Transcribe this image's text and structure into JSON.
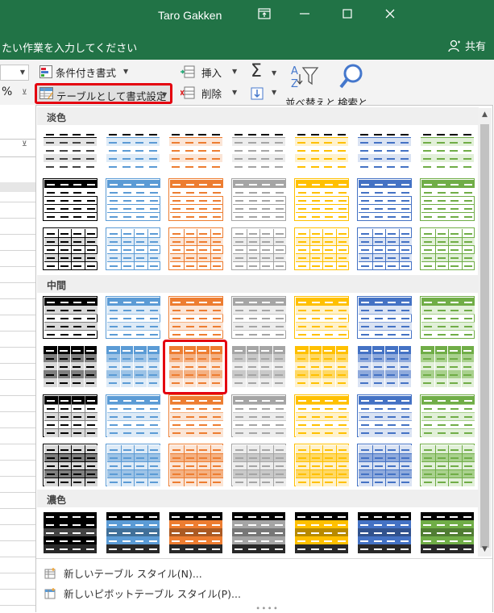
{
  "window": {
    "title": "Taro Gakken",
    "controls": [
      "ribbon-display-icon",
      "minimize-icon",
      "maximize-icon",
      "close-icon"
    ]
  },
  "tellme": {
    "text": "たい作業を入力してください"
  },
  "share": {
    "label": "共有"
  },
  "ribbon": {
    "conditional_format": "条件付き書式",
    "format_as_table": "テーブルとして書式設定",
    "insert": "挿入",
    "delete": "削除",
    "sort_filter": "並べ替えと",
    "find_select": "検索と",
    "percent": "%"
  },
  "gallery": {
    "sections": [
      {
        "label": "淡色"
      },
      {
        "label": "中間"
      },
      {
        "label": "濃色"
      }
    ],
    "colors": {
      "black": {
        "dark": "#000000",
        "mid": "#7f7f7f",
        "light": "#d9d9d9",
        "border": "#000000"
      },
      "blue": {
        "dark": "#5b9bd5",
        "mid": "#9dc3e6",
        "light": "#deebf7",
        "border": "#5b9bd5"
      },
      "orange": {
        "dark": "#ed7d31",
        "mid": "#f4b183",
        "light": "#fbe5d6",
        "border": "#ed7d31"
      },
      "gray": {
        "dark": "#a5a5a5",
        "mid": "#c9c9c9",
        "light": "#ededed",
        "border": "#a5a5a5"
      },
      "gold": {
        "dark": "#ffc000",
        "mid": "#ffd966",
        "light": "#fff2cc",
        "border": "#ffc000"
      },
      "navy": {
        "dark": "#4472c4",
        "mid": "#8faadc",
        "light": "#dae3f3",
        "border": "#4472c4"
      },
      "green": {
        "dark": "#70ad47",
        "mid": "#a9d18e",
        "light": "#e2f0d9",
        "border": "#70ad47"
      }
    },
    "selected_style": "中間 2行目 オレンジ"
  },
  "footer": {
    "new_table_style": "新しいテーブル スタイル(N)...",
    "new_pivot_style": "新しいピボットテーブル スタイル(P)..."
  }
}
